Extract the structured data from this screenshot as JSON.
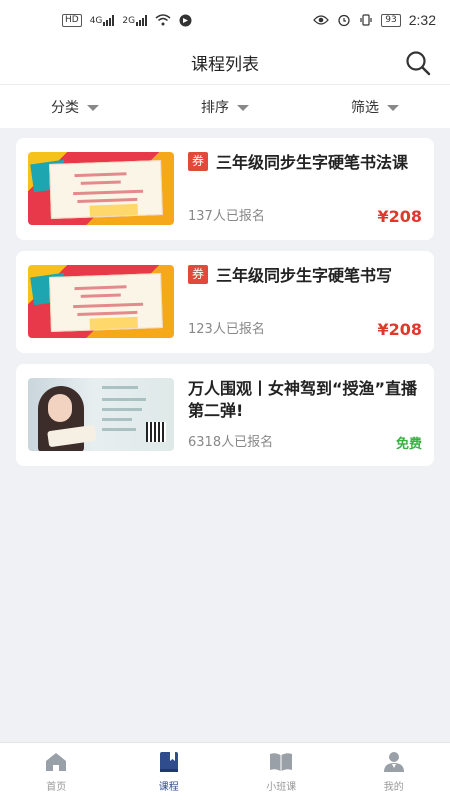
{
  "status": {
    "left_badge": "HD",
    "net1": "4G",
    "net2": "2G",
    "battery": "93",
    "time": "2:32"
  },
  "header": {
    "title": "课程列表"
  },
  "filters": [
    {
      "label": "分类"
    },
    {
      "label": "排序"
    },
    {
      "label": "筛选"
    }
  ],
  "courses": [
    {
      "badge": "券",
      "title": "三年级同步生字硬笔书法课",
      "enrolled": "137人已报名",
      "price": "¥208"
    },
    {
      "badge": "券",
      "title": "三年级同步生字硬笔书写",
      "enrolled": "123人已报名",
      "price": "¥208"
    },
    {
      "badge": "",
      "title": "万人围观丨女神驾到“授渔”直播第二弹!",
      "enrolled": "6318人已报名",
      "price": "免费"
    }
  ],
  "tabs": [
    {
      "label": "首页",
      "icon": "home-icon"
    },
    {
      "label": "课程",
      "icon": "book-icon",
      "active": true
    },
    {
      "label": "小班课",
      "icon": "open-book-icon"
    },
    {
      "label": "我的",
      "icon": "user-icon"
    }
  ],
  "colors": {
    "accent": "#2f4d8d",
    "price": "#e0382d",
    "free": "#3bb143",
    "coupon": "#e04a3b"
  }
}
